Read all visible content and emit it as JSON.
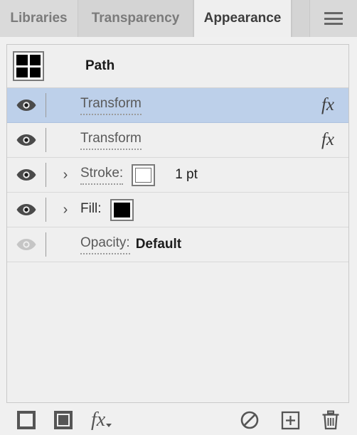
{
  "tabs": [
    {
      "label": "Libraries",
      "active": false
    },
    {
      "label": "Transparency",
      "active": false
    },
    {
      "label": "Appearance",
      "active": true
    }
  ],
  "menu_button": {
    "name": "panel-menu",
    "icon": "hamburger-icon"
  },
  "panel": {
    "header": {
      "title": "Path",
      "thumbnail": "path-thumbnail-icon"
    },
    "rows": [
      {
        "name": "transform-1",
        "label": "Transform",
        "selected": true,
        "visibility_icon": "eye-icon",
        "visible": true,
        "has_arrow": false,
        "fx_icon": "fx-icon",
        "dotted": true
      },
      {
        "name": "transform-2",
        "label": "Transform",
        "selected": false,
        "visibility_icon": "eye-icon",
        "visible": true,
        "has_arrow": false,
        "fx_icon": "fx-icon",
        "dotted": true
      },
      {
        "name": "stroke",
        "label": "Stroke:",
        "selected": false,
        "visibility_icon": "eye-icon",
        "visible": true,
        "has_arrow": true,
        "arrow_icon": "chevron-right-icon",
        "swatch": "white-swatch",
        "swatch_color": "#ffffff",
        "value": "1 pt",
        "dotted": true
      },
      {
        "name": "fill",
        "label": "Fill:",
        "selected": false,
        "visibility_icon": "eye-icon",
        "visible": true,
        "has_arrow": true,
        "arrow_icon": "chevron-right-icon",
        "swatch": "black-swatch",
        "swatch_color": "#000000",
        "dotted": false
      },
      {
        "name": "opacity",
        "label": "Opacity:",
        "selected": false,
        "visibility_icon": "eye-icon",
        "visible": false,
        "has_arrow": false,
        "value": "Default",
        "dotted": true
      }
    ]
  },
  "toolbar": {
    "left": [
      {
        "name": "add-new-stroke-button",
        "icon": "square-outline-icon"
      },
      {
        "name": "add-new-fill-button",
        "icon": "square-filled-icon"
      },
      {
        "name": "add-new-effect-button",
        "icon": "fx-dropdown-icon"
      }
    ],
    "right": [
      {
        "name": "clear-appearance-button",
        "icon": "no-symbol-icon"
      },
      {
        "name": "duplicate-item-button",
        "icon": "plus-box-icon"
      },
      {
        "name": "delete-item-button",
        "icon": "trash-icon"
      }
    ]
  },
  "colors": {
    "selection": "#bdd0ea",
    "panel_bg": "#efefef",
    "tabbar_bg": "#d7d7d7",
    "text": "#5a5a5a"
  }
}
